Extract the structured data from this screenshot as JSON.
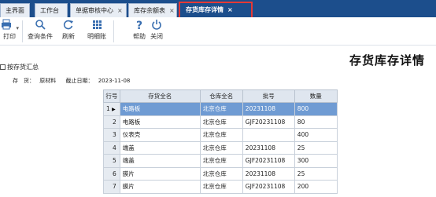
{
  "tabs": [
    {
      "label": "主界面",
      "closable": false
    },
    {
      "label": "工作台",
      "closable": false
    },
    {
      "label": "单据审核中心",
      "closable": true
    },
    {
      "label": "库存余额表",
      "closable": true
    },
    {
      "label": "存货库存详情",
      "closable": true,
      "active": true
    }
  ],
  "close_glyph": "×",
  "toolbar": {
    "print": "打印",
    "query": "查询条件",
    "refresh": "刷新",
    "detail": "明细账",
    "help": "帮助",
    "close": "关闭"
  },
  "page_title": "存货库存详情",
  "summary_checkbox": "按存货汇总",
  "info": {
    "inventory_label": "存　货：",
    "inventory_value": "原材料",
    "date_label": "截止日期：",
    "date_value": "2023-11-08"
  },
  "table": {
    "headers": [
      "行号",
      "存货全名",
      "仓库全名",
      "批号",
      "数量"
    ],
    "rows": [
      {
        "no": "1",
        "name": "电路板",
        "warehouse": "北京仓库",
        "batch": "20231108",
        "qty": "800"
      },
      {
        "no": "2",
        "name": "电路板",
        "warehouse": "北京仓库",
        "batch": "GJF20231108",
        "qty": "80"
      },
      {
        "no": "3",
        "name": "仪表壳",
        "warehouse": "北京仓库",
        "batch": "",
        "qty": "400"
      },
      {
        "no": "4",
        "name": "端盖",
        "warehouse": "北京仓库",
        "batch": "20231108",
        "qty": "25"
      },
      {
        "no": "5",
        "name": "端盖",
        "warehouse": "北京仓库",
        "batch": "GJF20231108",
        "qty": "300"
      },
      {
        "no": "6",
        "name": "膜片",
        "warehouse": "北京仓库",
        "batch": "20231108",
        "qty": "25"
      },
      {
        "no": "7",
        "name": "膜片",
        "warehouse": "北京仓库",
        "batch": "GJF20231108",
        "qty": "200"
      }
    ]
  }
}
